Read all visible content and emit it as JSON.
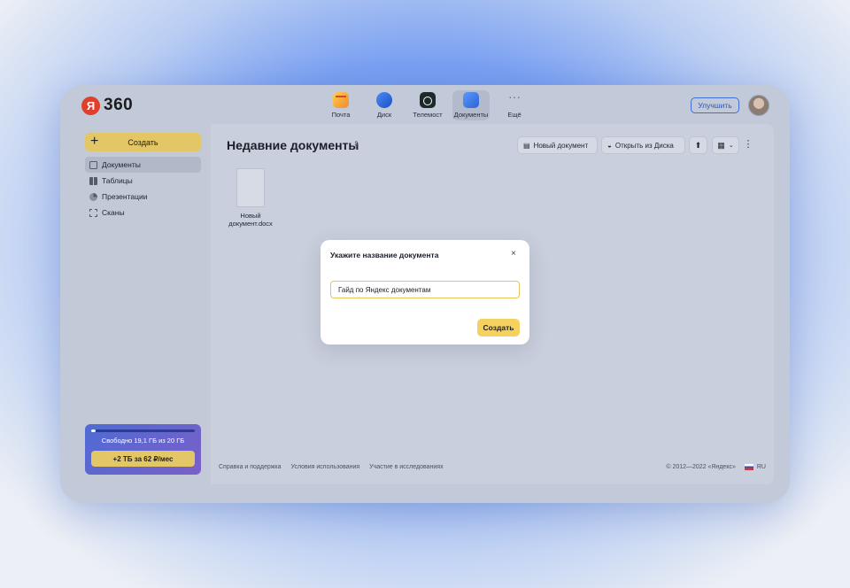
{
  "brand": {
    "badge": "Я",
    "name": "360"
  },
  "apps": [
    {
      "label": "Почта",
      "icon": "mail-icon"
    },
    {
      "label": "Диск",
      "icon": "disk-icon"
    },
    {
      "label": "Телемост",
      "icon": "telemost-icon"
    },
    {
      "label": "Документы",
      "icon": "documents-icon",
      "active": true
    },
    {
      "label": "Ещё",
      "icon": "more-dots-icon"
    }
  ],
  "header": {
    "upgrade_label": "Улучшить"
  },
  "sidebar": {
    "create_label": "Создать",
    "items": [
      {
        "label": "Документы",
        "icon": "document-icon",
        "active": true
      },
      {
        "label": "Таблицы",
        "icon": "spreadsheet-icon"
      },
      {
        "label": "Презентации",
        "icon": "presentation-icon"
      },
      {
        "label": "Сканы",
        "icon": "scan-icon"
      }
    ],
    "storage": {
      "text": "Свободно 19,1 ГБ из 20 ГБ",
      "used_fraction": 0.045,
      "button_label": "+2 ТБ  за 62 ₽/мес"
    }
  },
  "main": {
    "title": "Недавние документы",
    "toolbar": {
      "new_doc_label": "Новый документ",
      "open_disk_label": "Открыть из Диска"
    },
    "files": [
      {
        "name_line1": "Новый",
        "name_line2": "документ.docx"
      }
    ]
  },
  "footer": {
    "links": [
      "Справка и поддержка",
      "Условия использования",
      "Участие в исследованиях"
    ],
    "copyright": "© 2012—2022 «Яндекс»",
    "lang": "RU"
  },
  "dialog": {
    "title": "Укажите название документа",
    "close_icon": "×",
    "input_value": "Гайд по Яндекс документам",
    "submit_label": "Создать"
  }
}
